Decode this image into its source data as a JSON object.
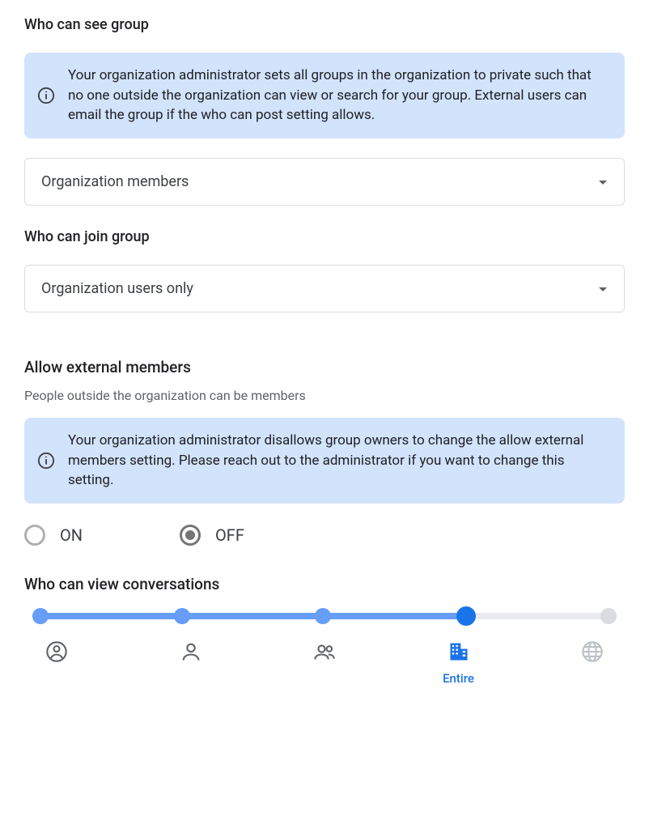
{
  "sections": {
    "who_can_see": {
      "label": "Who can see group",
      "info": "Your organization administrator sets all groups in the organization to private such that no one outside the organization can view or search for your group. External users can email the group if the who can post setting allows.",
      "select_value": "Organization members"
    },
    "who_can_join": {
      "label": "Who can join group",
      "select_value": "Organization users only"
    },
    "allow_external": {
      "heading": "Allow external members",
      "description": "People outside the organization can be members",
      "info": "Your organization administrator disallows group owners to change the allow external members setting. Please reach out to the administrator if you want to change this setting.",
      "option_on": "ON",
      "option_off": "OFF",
      "selected": "OFF"
    },
    "who_can_view_convos": {
      "label": "Who can view conversations",
      "active_index": 3,
      "stops": [
        {
          "icon": "account-circle-icon",
          "label": ""
        },
        {
          "icon": "person-icon",
          "label": ""
        },
        {
          "icon": "people-icon",
          "label": ""
        },
        {
          "icon": "building-icon",
          "label": "Entire"
        },
        {
          "icon": "globe-icon",
          "label": ""
        }
      ]
    }
  }
}
